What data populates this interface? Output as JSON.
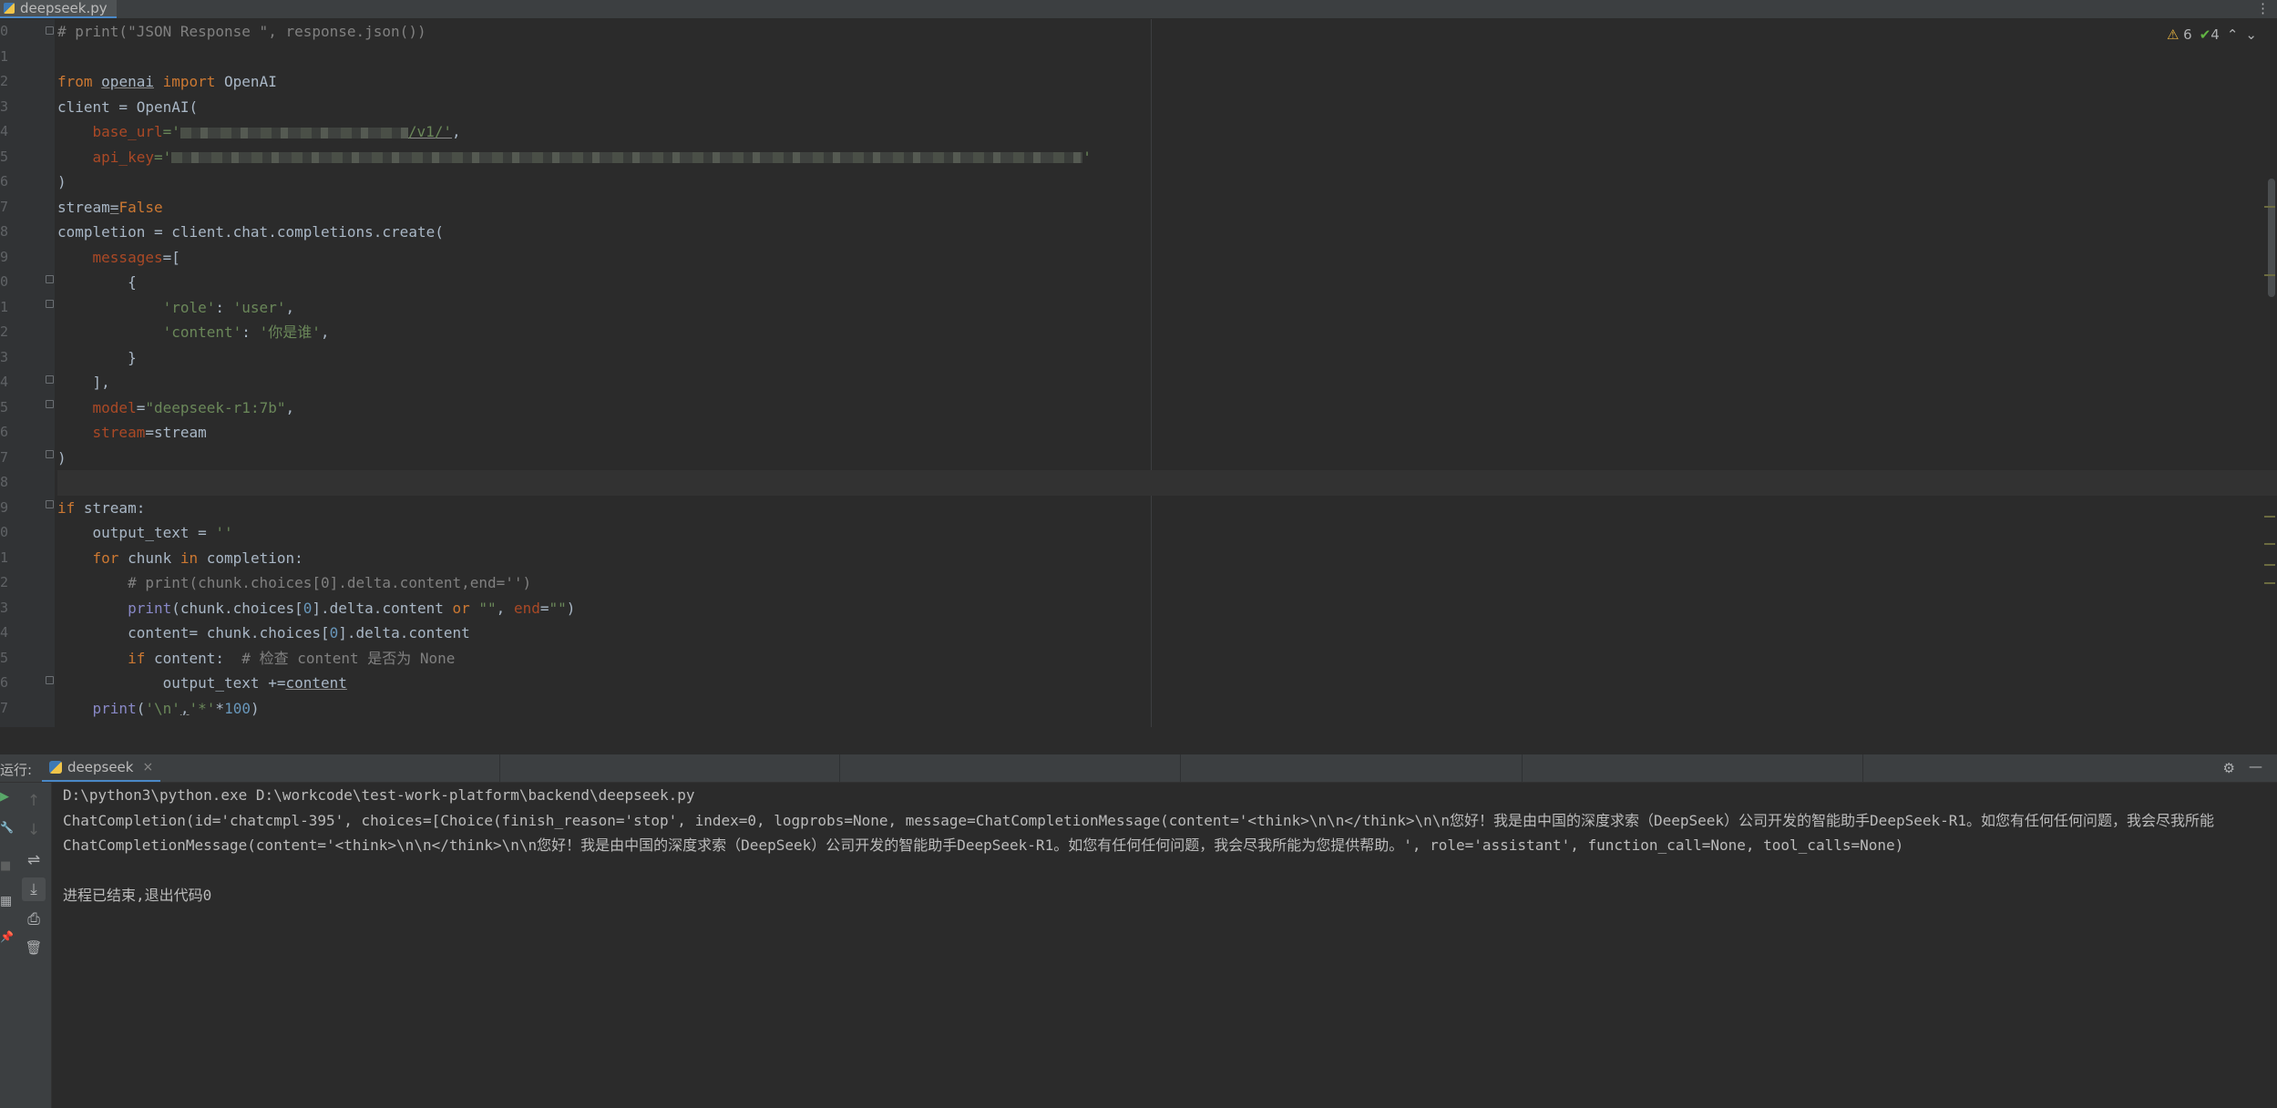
{
  "tabs": {
    "file": "deepseek.py",
    "menu": "⋮"
  },
  "gutter": {
    "line_numbers": [
      "0",
      "1",
      "2",
      "3",
      "4",
      "5",
      "6",
      "7",
      "8",
      "9",
      "0",
      "1",
      "2",
      "3",
      "4",
      "5",
      "6",
      "7",
      "8",
      "9",
      "0",
      "1",
      "2",
      "3",
      "4",
      "5",
      "6",
      "7"
    ]
  },
  "inspections": {
    "warnings": "6",
    "ok": "4",
    "up": "⌃",
    "down": "⌄",
    "warn_icon": "⚠",
    "ok_icon": "✔"
  },
  "code": {
    "l0": "# print(\"JSON Response \", response.json())",
    "l2_from": "from ",
    "l2_mod": "openai",
    "l2_import": " import ",
    "l2_cls": "OpenAI",
    "l3": "client = OpenAI(",
    "l4_key": "base_url",
    "l4_eq": "='",
    "l4_tail": "/v1/'",
    "l4_comma": ",",
    "l5_key": "api_key",
    "l5_eq": "='",
    "l5_tail": "'",
    "l6": ")",
    "l7_name": "stream",
    "l7_eq": "=",
    "l7_val": "False",
    "l8": "completion = client.chat.completions.create(",
    "l9_key": "messages",
    "l9_rest": "=[",
    "l10": "{",
    "l11_k": "'role'",
    "l11_c": ": ",
    "l11_v": "'user'",
    "l11_e": ",",
    "l12_k": "'content'",
    "l12_c": ": ",
    "l12_v": "'你是谁'",
    "l12_e": ",",
    "l13": "}",
    "l14": "],",
    "l15_key": "model",
    "l15_eq": "=",
    "l15_val": "\"deepseek-r1:7b\"",
    "l15_e": ",",
    "l16_key": "stream",
    "l16_rest": "=stream",
    "l17": ")",
    "l19_if": "if",
    "l19_rest": " stream:",
    "l20_a": "output_text = ",
    "l20_b": "''",
    "l21_for": "for",
    "l21_b": " chunk ",
    "l21_in": "in",
    "l21_c": " completion:",
    "l22": "# print(chunk.choices[0].delta.content,end='')",
    "l23_a": "print",
    "l23_b": "(chunk.choices[",
    "l23_n": "0",
    "l23_c": "].delta.content ",
    "l23_or": "or",
    "l23_d": " ",
    "l23_s1": "\"\"",
    "l23_e": ", ",
    "l23_end": "end",
    "l23_f": "=",
    "l23_s2": "\"\"",
    "l23_g": ")",
    "l24_a": "content",
    "l24_b": "= chunk.choices[",
    "l24_n": "0",
    "l24_c": "].delta.content",
    "l25_if": "if",
    "l25_a": " content:  ",
    "l25_cm": "# 检查 content 是否为 None",
    "l26_a": "output_text +=",
    "l26_b": "content",
    "l27_a": "print",
    "l27_b": "(",
    "l27_s1": "'\\n'",
    "l27_c": ",",
    "l27_s2": "'*'",
    "l27_d": "*",
    "l27_n": "100",
    "l27_e": ")"
  },
  "run": {
    "label": "运行:",
    "tab": "deepseek",
    "tab_close": "×",
    "settings_icon": "⚙",
    "minimize_icon": "—",
    "toolbar": {
      "run": "▶",
      "up": "↑",
      "wrench": "🔧",
      "down": "↓",
      "stop": "■",
      "wrap": "⇌",
      "layout": "▦",
      "scroll_end": "⤓",
      "pin": "📌",
      "print": "⎙",
      "trash": "🗑"
    },
    "console": [
      "D:\\python3\\python.exe D:\\workcode\\test-work-platform\\backend\\deepseek.py",
      "ChatCompletion(id='chatcmpl-395', choices=[Choice(finish_reason='stop', index=0, logprobs=None, message=ChatCompletionMessage(content='<think>\\n\\n</think>\\n\\n您好！我是由中国的深度求索（DeepSeek）公司开发的智能助手DeepSeek-R1。如您有任何任何问题，我会尽我所能",
      "ChatCompletionMessage(content='<think>\\n\\n</think>\\n\\n您好！我是由中国的深度求索（DeepSeek）公司开发的智能助手DeepSeek-R1。如您有任何任何问题，我会尽我所能为您提供帮助。', role='assistant', function_call=None, tool_calls=None)",
      "",
      "进程已结束,退出代码0"
    ]
  }
}
